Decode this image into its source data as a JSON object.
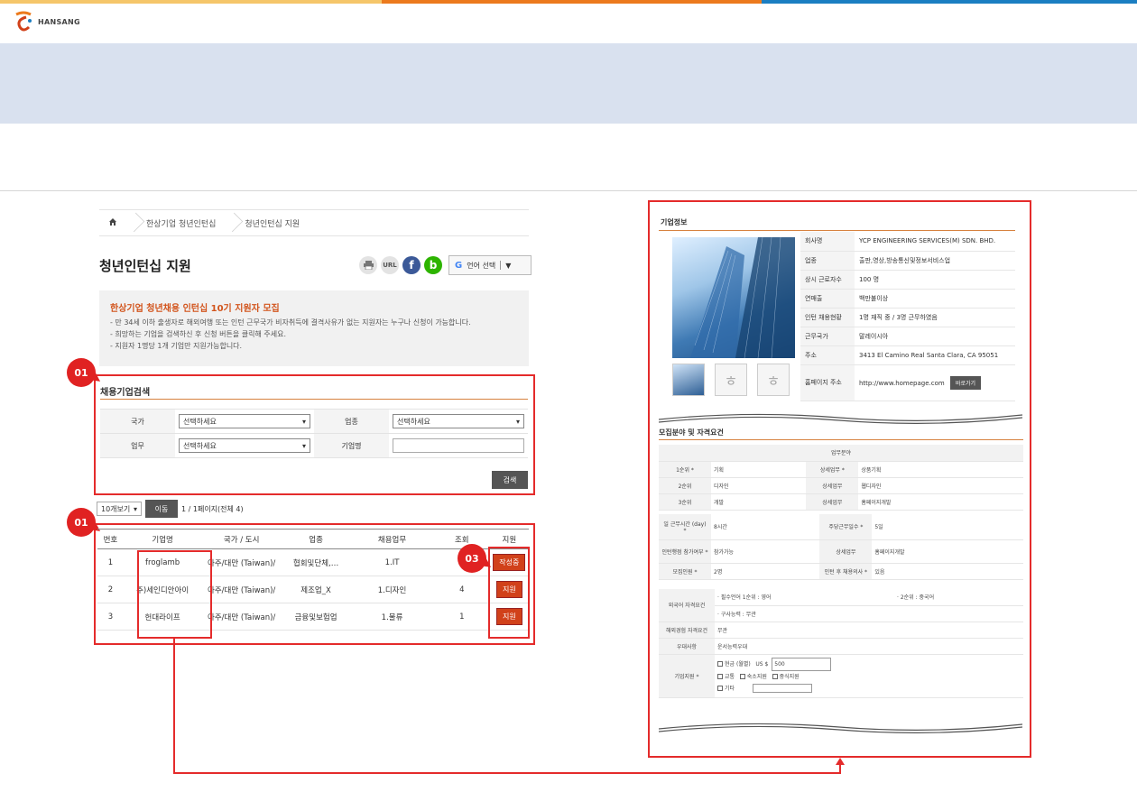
{
  "colors": {
    "bar1": "#f5c66a",
    "bar2": "#ec7a1d",
    "bar3": "#1b7ec2",
    "accent": "#e42b2b",
    "orange": "#d1411a"
  },
  "brand": {
    "name": "HANSANG"
  },
  "breadcrumb": {
    "items": [
      "한상기업 청년인턴십",
      "청년인턴십 지원"
    ]
  },
  "page": {
    "title": "청년인턴십 지원"
  },
  "tools": {
    "print": "print-icon",
    "url": "URL",
    "facebook": "f",
    "blog": "b",
    "lang_label": "언어 선택",
    "lang_arrow": "▼"
  },
  "notice": {
    "head": "한상기업 청년채용 인턴십 10기 지원자 모집",
    "lines": [
      "- 만 34세 이하 출생자로 해외여행 또는 인턴 근무국가 비자취득에 결격사유가 없는 지원자는 누구나 신청이 가능합니다.",
      "- 희망하는 기업을 검색하신 후 신청 버튼을 클릭해 주세요.",
      "- 지원자 1명당 1개 기업만 지원가능합니다."
    ]
  },
  "badges": {
    "b1": "01",
    "b2": "01",
    "b3": "03"
  },
  "search": {
    "title": "채용기업검색",
    "country_label": "국가",
    "country_value": "선택하세요",
    "industry_label": "업종",
    "industry_value": "선택하세요",
    "duty_label": "업무",
    "duty_value": "선택하세요",
    "company_label": "기업명",
    "company_value": "",
    "button": "검색"
  },
  "pager": {
    "per_page": "10개보기",
    "go": "이동",
    "info": "1 / 1페이지(전체 4)"
  },
  "list": {
    "headers": [
      "번호",
      "기업명",
      "국가 / 도시",
      "업종",
      "채용업무",
      "조회",
      "지원"
    ],
    "rows": [
      {
        "no": "1",
        "company": "froglamb",
        "country": "아주/대만 (Taiwan)/",
        "industry": "협회및단체,…",
        "job": "1.IT",
        "views": "",
        "apply": "작성중"
      },
      {
        "no": "2",
        "company": "주)세인디안아이",
        "country": "아주/대만 (Taiwan)/",
        "industry": "제조업_X",
        "job": "1.디자인",
        "views": "4",
        "apply": "지원"
      },
      {
        "no": "3",
        "company": "헌대라이프",
        "country": "아주/대만 (Taiwan)/",
        "industry": "금융및보험업",
        "job": "1.물류",
        "views": "1",
        "apply": "지원"
      }
    ]
  },
  "company": {
    "section": "기업정보",
    "rows": [
      {
        "label": "회사명",
        "value": "YCP ENGINEERING SERVICES(M) SDN. BHD."
      },
      {
        "label": "업종",
        "value": "출판,영상,방송통신및정보서비스업"
      },
      {
        "label": "상시 근로자수",
        "value": "100 명"
      },
      {
        "label": "연매출",
        "value": "백만불이상"
      },
      {
        "label": "인턴 채용현황",
        "value": "1명 재직 중 / 3명 근무하였음"
      },
      {
        "label": "근무국가",
        "value": "말레이시아"
      },
      {
        "label": "주소",
        "value": "3413 El Camino Real Santa Clara, CA 95051"
      },
      {
        "label": "홈페이지 주소",
        "value": "http://www.homepage.com",
        "button": "바로가기"
      }
    ]
  },
  "recruit": {
    "section": "모집분야 및 자격요건",
    "duty_header": "업무분야",
    "r1": {
      "l1": "1순위 *",
      "v1": "기획",
      "l2": "상세업무 *",
      "v2": "상품기획"
    },
    "r2": {
      "l1": "2순위",
      "v1": "디자인",
      "l2": "상세업무",
      "v2": "웹디자인"
    },
    "r3": {
      "l1": "3순위",
      "v1": "개발",
      "l2": "상세업무",
      "v2": "홈페이지개발"
    },
    "r4": {
      "l1": "일 근무시간 (day) *",
      "v1": "8시간",
      "l2": "주당근무일수 *",
      "v2": "5일"
    },
    "r5": {
      "l1": "인턴행점 참가여부 *",
      "v1": "참가가능",
      "l2": "상세업무",
      "v2": "홈페이지개발"
    },
    "r6": {
      "l1": "모집인원 *",
      "v1": "2명",
      "l2": "인턴 후 채용의사 *",
      "v2": "있음"
    },
    "lang_label": "외국어 자격요건",
    "lang_v1": "· 필수언어 1순위 : 영어",
    "lang_v2": "· 2순위 : 중국어",
    "lang_v3": "· 구사능력 : 무관",
    "overseas_label": "해외경험 자격요건",
    "overseas_value": "무관",
    "pref_label": "우대사항",
    "pref_value": "운서능력우대",
    "support_label": "기업지원 *",
    "s_salary": "현금 (월별)",
    "s_currency": "US $",
    "s_amount": "500",
    "s_transport": "교통",
    "s_housing": "숙소지원",
    "s_meal": "중식지원",
    "s_other": "기타"
  }
}
